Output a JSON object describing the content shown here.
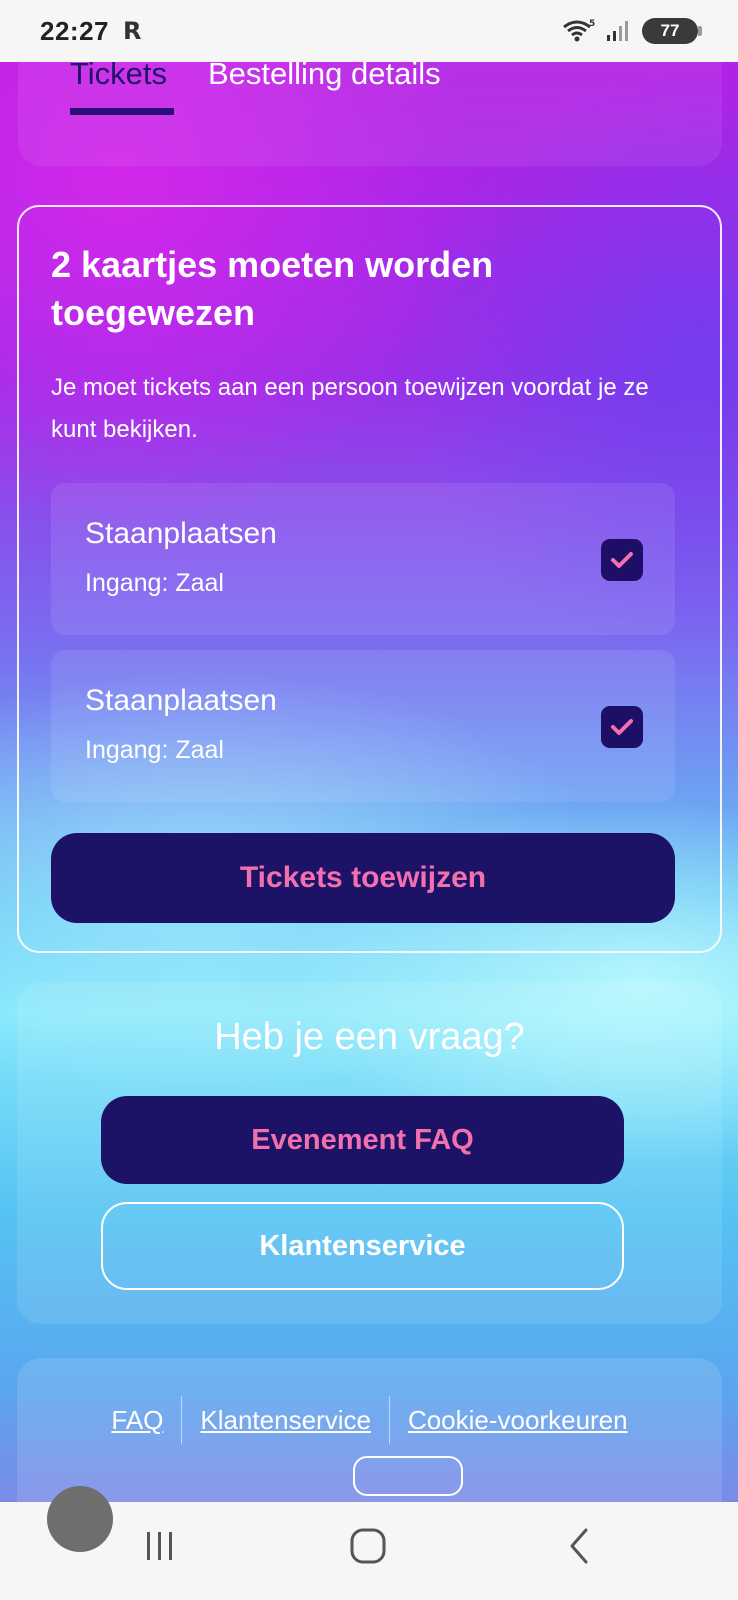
{
  "status_bar": {
    "time": "22:27",
    "carrier_icon": "R",
    "battery": "77"
  },
  "tabs": [
    {
      "label": "Tickets",
      "active": true
    },
    {
      "label": "Bestelling details",
      "active": false
    }
  ],
  "assign_card": {
    "title": "2 kaartjes moeten worden toegewezen",
    "description": "Je moet tickets aan een persoon toewijzen voordat je ze kunt bekijken.",
    "tickets": [
      {
        "name": "Staanplaatsen",
        "entry": "Ingang: Zaal",
        "checked": true
      },
      {
        "name": "Staanplaatsen",
        "entry": "Ingang: Zaal",
        "checked": true
      }
    ],
    "button_label": "Tickets toewijzen"
  },
  "help_card": {
    "title": "Heb je een vraag?",
    "faq_button": "Evenement FAQ",
    "service_button": "Klantenservice"
  },
  "footer": {
    "links": [
      "FAQ",
      "Klantenservice",
      "Cookie-voorkeuren"
    ]
  },
  "colors": {
    "accent_dark": "#1d1366",
    "accent_pink": "#f36fae",
    "tab_underline": "#2a0f7a"
  }
}
